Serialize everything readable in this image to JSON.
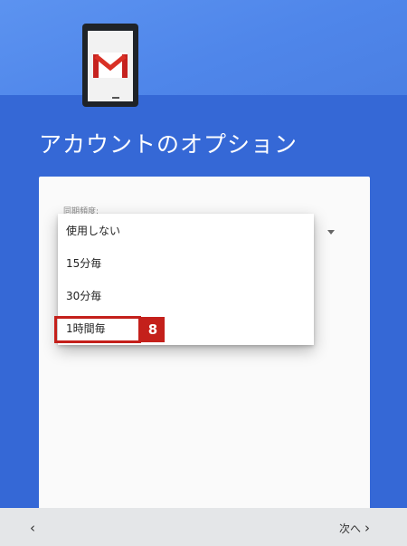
{
  "header": {
    "title": "アカウントのオプション",
    "illustration_icon": "gmail-icon"
  },
  "form": {
    "sync_frequency_label": "同期頻度:",
    "dropdown_icon": "triangle-down-icon"
  },
  "menu": {
    "options": [
      "使用しない",
      "15分毎",
      "30分毎",
      "1時間毎"
    ],
    "highlighted_index": 3
  },
  "annotation": {
    "step_number": "8",
    "highlight_color": "#c4201b"
  },
  "footer": {
    "back_symbol": "‹",
    "next_label": "次へ",
    "next_symbol": "›"
  },
  "colors": {
    "background_blue": "#3568d6",
    "hero_blue": "#5c93f0",
    "card": "#fafafa",
    "footer": "#e4e6e8"
  }
}
